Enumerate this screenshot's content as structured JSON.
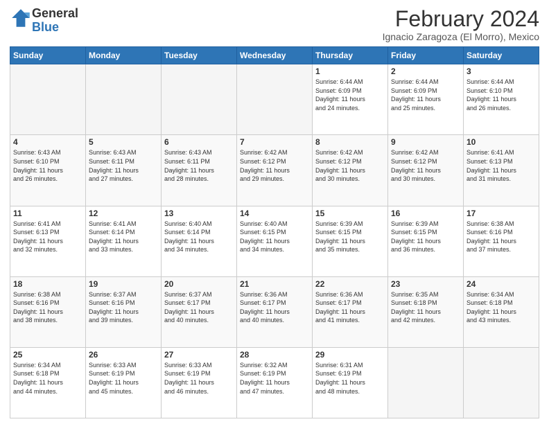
{
  "header": {
    "logo_general": "General",
    "logo_blue": "Blue",
    "main_title": "February 2024",
    "subtitle": "Ignacio Zaragoza (El Morro), Mexico"
  },
  "days_of_week": [
    "Sunday",
    "Monday",
    "Tuesday",
    "Wednesday",
    "Thursday",
    "Friday",
    "Saturday"
  ],
  "weeks": [
    [
      {
        "day": "",
        "info": ""
      },
      {
        "day": "",
        "info": ""
      },
      {
        "day": "",
        "info": ""
      },
      {
        "day": "",
        "info": ""
      },
      {
        "day": "1",
        "info": "Sunrise: 6:44 AM\nSunset: 6:09 PM\nDaylight: 11 hours\nand 24 minutes."
      },
      {
        "day": "2",
        "info": "Sunrise: 6:44 AM\nSunset: 6:09 PM\nDaylight: 11 hours\nand 25 minutes."
      },
      {
        "day": "3",
        "info": "Sunrise: 6:44 AM\nSunset: 6:10 PM\nDaylight: 11 hours\nand 26 minutes."
      }
    ],
    [
      {
        "day": "4",
        "info": "Sunrise: 6:43 AM\nSunset: 6:10 PM\nDaylight: 11 hours\nand 26 minutes."
      },
      {
        "day": "5",
        "info": "Sunrise: 6:43 AM\nSunset: 6:11 PM\nDaylight: 11 hours\nand 27 minutes."
      },
      {
        "day": "6",
        "info": "Sunrise: 6:43 AM\nSunset: 6:11 PM\nDaylight: 11 hours\nand 28 minutes."
      },
      {
        "day": "7",
        "info": "Sunrise: 6:42 AM\nSunset: 6:12 PM\nDaylight: 11 hours\nand 29 minutes."
      },
      {
        "day": "8",
        "info": "Sunrise: 6:42 AM\nSunset: 6:12 PM\nDaylight: 11 hours\nand 30 minutes."
      },
      {
        "day": "9",
        "info": "Sunrise: 6:42 AM\nSunset: 6:12 PM\nDaylight: 11 hours\nand 30 minutes."
      },
      {
        "day": "10",
        "info": "Sunrise: 6:41 AM\nSunset: 6:13 PM\nDaylight: 11 hours\nand 31 minutes."
      }
    ],
    [
      {
        "day": "11",
        "info": "Sunrise: 6:41 AM\nSunset: 6:13 PM\nDaylight: 11 hours\nand 32 minutes."
      },
      {
        "day": "12",
        "info": "Sunrise: 6:41 AM\nSunset: 6:14 PM\nDaylight: 11 hours\nand 33 minutes."
      },
      {
        "day": "13",
        "info": "Sunrise: 6:40 AM\nSunset: 6:14 PM\nDaylight: 11 hours\nand 34 minutes."
      },
      {
        "day": "14",
        "info": "Sunrise: 6:40 AM\nSunset: 6:15 PM\nDaylight: 11 hours\nand 34 minutes."
      },
      {
        "day": "15",
        "info": "Sunrise: 6:39 AM\nSunset: 6:15 PM\nDaylight: 11 hours\nand 35 minutes."
      },
      {
        "day": "16",
        "info": "Sunrise: 6:39 AM\nSunset: 6:15 PM\nDaylight: 11 hours\nand 36 minutes."
      },
      {
        "day": "17",
        "info": "Sunrise: 6:38 AM\nSunset: 6:16 PM\nDaylight: 11 hours\nand 37 minutes."
      }
    ],
    [
      {
        "day": "18",
        "info": "Sunrise: 6:38 AM\nSunset: 6:16 PM\nDaylight: 11 hours\nand 38 minutes."
      },
      {
        "day": "19",
        "info": "Sunrise: 6:37 AM\nSunset: 6:16 PM\nDaylight: 11 hours\nand 39 minutes."
      },
      {
        "day": "20",
        "info": "Sunrise: 6:37 AM\nSunset: 6:17 PM\nDaylight: 11 hours\nand 40 minutes."
      },
      {
        "day": "21",
        "info": "Sunrise: 6:36 AM\nSunset: 6:17 PM\nDaylight: 11 hours\nand 40 minutes."
      },
      {
        "day": "22",
        "info": "Sunrise: 6:36 AM\nSunset: 6:17 PM\nDaylight: 11 hours\nand 41 minutes."
      },
      {
        "day": "23",
        "info": "Sunrise: 6:35 AM\nSunset: 6:18 PM\nDaylight: 11 hours\nand 42 minutes."
      },
      {
        "day": "24",
        "info": "Sunrise: 6:34 AM\nSunset: 6:18 PM\nDaylight: 11 hours\nand 43 minutes."
      }
    ],
    [
      {
        "day": "25",
        "info": "Sunrise: 6:34 AM\nSunset: 6:18 PM\nDaylight: 11 hours\nand 44 minutes."
      },
      {
        "day": "26",
        "info": "Sunrise: 6:33 AM\nSunset: 6:19 PM\nDaylight: 11 hours\nand 45 minutes."
      },
      {
        "day": "27",
        "info": "Sunrise: 6:33 AM\nSunset: 6:19 PM\nDaylight: 11 hours\nand 46 minutes."
      },
      {
        "day": "28",
        "info": "Sunrise: 6:32 AM\nSunset: 6:19 PM\nDaylight: 11 hours\nand 47 minutes."
      },
      {
        "day": "29",
        "info": "Sunrise: 6:31 AM\nSunset: 6:19 PM\nDaylight: 11 hours\nand 48 minutes."
      },
      {
        "day": "",
        "info": ""
      },
      {
        "day": "",
        "info": ""
      }
    ]
  ]
}
